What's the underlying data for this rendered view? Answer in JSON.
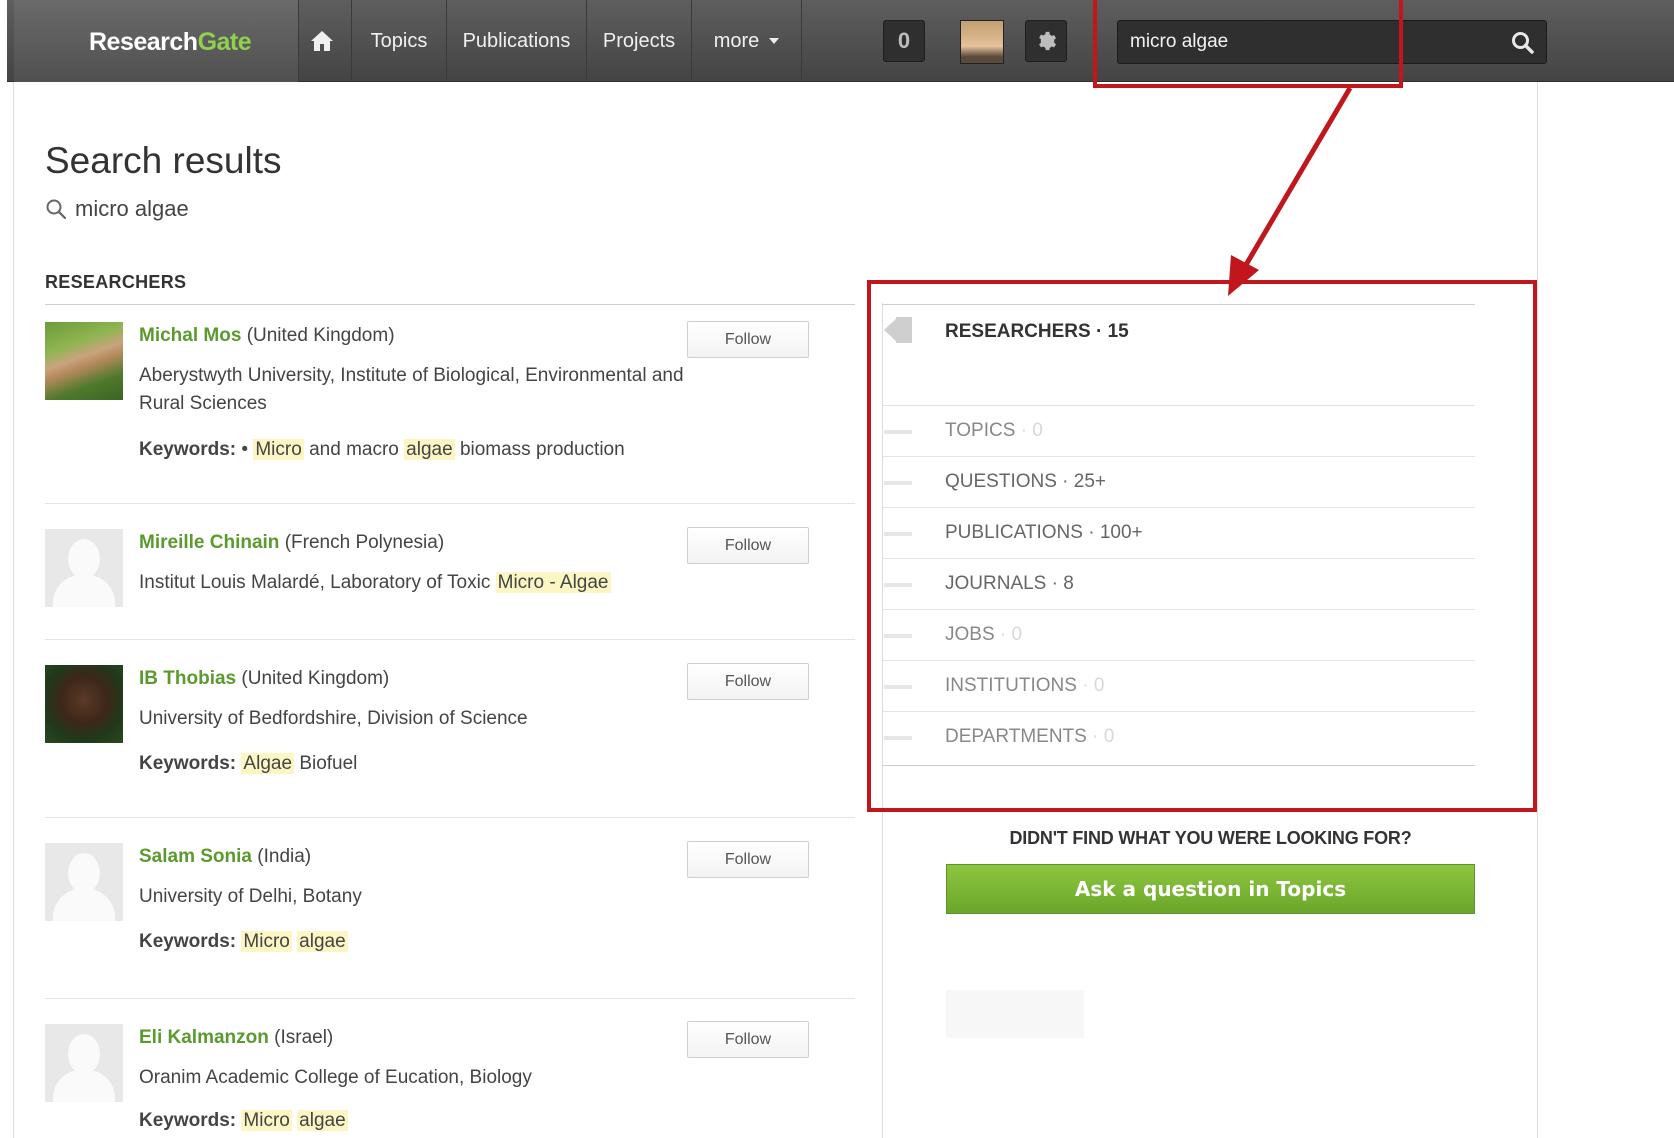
{
  "topbar": {
    "logo_word": "Research",
    "logo_accent": "Gate",
    "nav": [
      {
        "label": "Topics"
      },
      {
        "label": "Publications"
      },
      {
        "label": "Projects"
      },
      {
        "label": "more"
      }
    ],
    "notifications_count": "0",
    "search_value": "micro algae",
    "icons": {
      "home": "home-icon",
      "settings": "gear-icon",
      "search": "search-icon"
    }
  },
  "main": {
    "title": "Search results",
    "query": "micro algae",
    "section_heading": "RESEARCHERS",
    "follow_label": "Follow",
    "keywords_label": "Keywords:",
    "researchers": [
      {
        "name": "Michal Mos",
        "country": "(United Kingdom)",
        "affiliation": "Aberystwyth University, Institute of Biological, Environmental and Rural Sciences",
        "kw": {
          "prefix": "•",
          "t1": "Micro",
          "t2": "and macro",
          "t3": "algae",
          "t4": "biomass production"
        }
      },
      {
        "name": "Mireille Chinain",
        "country": "(French Polynesia)",
        "affiliation_prefix": "Institut Louis Malardé, Laboratory of Toxic",
        "affiliation_hl": "Micro - Algae"
      },
      {
        "name": "IB Thobias",
        "country": "(United Kingdom)",
        "affiliation": "University of Bedfordshire, Division of Science",
        "kw": {
          "t1": "Algae",
          "t2": "Biofuel"
        }
      },
      {
        "name": "Salam Sonia",
        "country": "(India)",
        "affiliation": "University of Delhi, Botany",
        "kw": {
          "t1": "Micro",
          "t2": "algae"
        }
      },
      {
        "name": "Eli Kalmanzon",
        "country": "(Israel)",
        "affiliation": "Oranim Academic College of Eucation, Biology",
        "kw": {
          "t1": "Micro",
          "t2": "algae"
        }
      }
    ]
  },
  "filters": {
    "items": [
      {
        "label": "RESEARCHERS",
        "count": "15",
        "active": true
      },
      {
        "label": "TOPICS",
        "count": "0"
      },
      {
        "label": "QUESTIONS",
        "count": "25+"
      },
      {
        "label": "PUBLICATIONS",
        "count": "100+"
      },
      {
        "label": "JOURNALS",
        "count": "8"
      },
      {
        "label": "JOBS",
        "count": "0"
      },
      {
        "label": "INSTITUTIONS",
        "count": "0"
      },
      {
        "label": "DEPARTMENTS",
        "count": "0"
      }
    ],
    "separator": " · "
  },
  "help": {
    "prompt": "DIDN'T FIND WHAT YOU WERE LOOKING FOR?",
    "ask_button": "Ask a question in Topics"
  },
  "colors": {
    "brand_green": "#8fd14f",
    "link_green": "#5a9a2e",
    "highlight": "#fbf6c3",
    "annotation_red": "#c0161c"
  }
}
